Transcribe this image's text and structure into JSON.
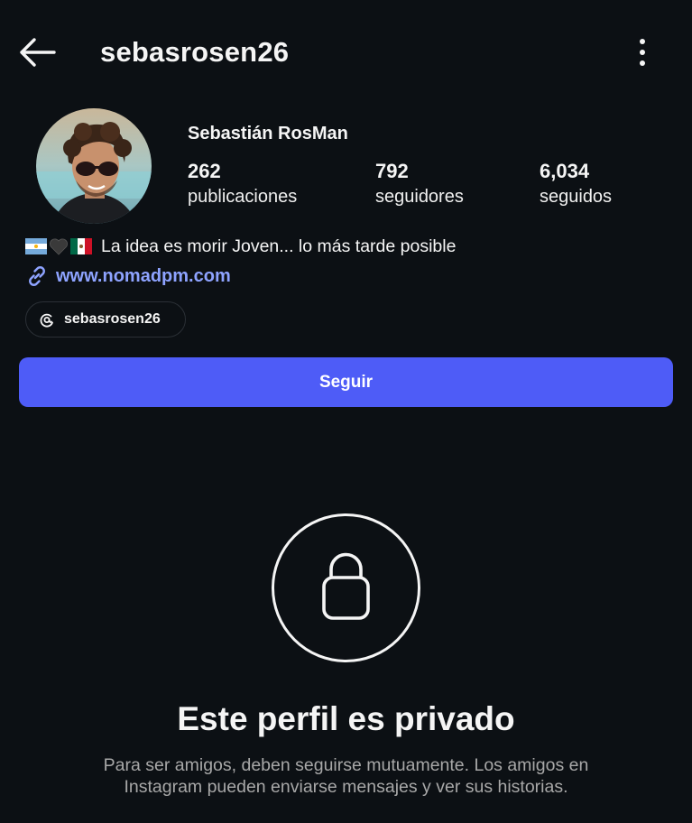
{
  "header": {
    "username": "sebasrosen26",
    "back_icon": "arrow-left-icon",
    "more_icon": "vertical-dots-icon"
  },
  "profile": {
    "display_name": "Sebastián RosMan",
    "stats": [
      {
        "value": "262",
        "label": "publicaciones"
      },
      {
        "value": "792",
        "label": "seguidores"
      },
      {
        "value": "6,034",
        "label": "seguidos"
      }
    ],
    "bio_text": "La idea es morir Joven... lo más tarde posible",
    "bio_flags": [
      "argentina-flag-icon",
      "black-heart-icon",
      "mexico-flag-icon"
    ],
    "link": "www.nomadpm.com",
    "threads_handle": "sebasrosen26"
  },
  "actions": {
    "follow_label": "Seguir"
  },
  "private_notice": {
    "title": "Este perfil es privado",
    "description": "Para ser amigos, deben seguirse mutuamente. Los amigos en Instagram pueden enviarse mensajes y ver sus historias."
  },
  "colors": {
    "background": "#0c1014",
    "primary_button": "#4e5cf7",
    "link": "#8ea3ff",
    "secondary_text": "#a8a8a8"
  }
}
